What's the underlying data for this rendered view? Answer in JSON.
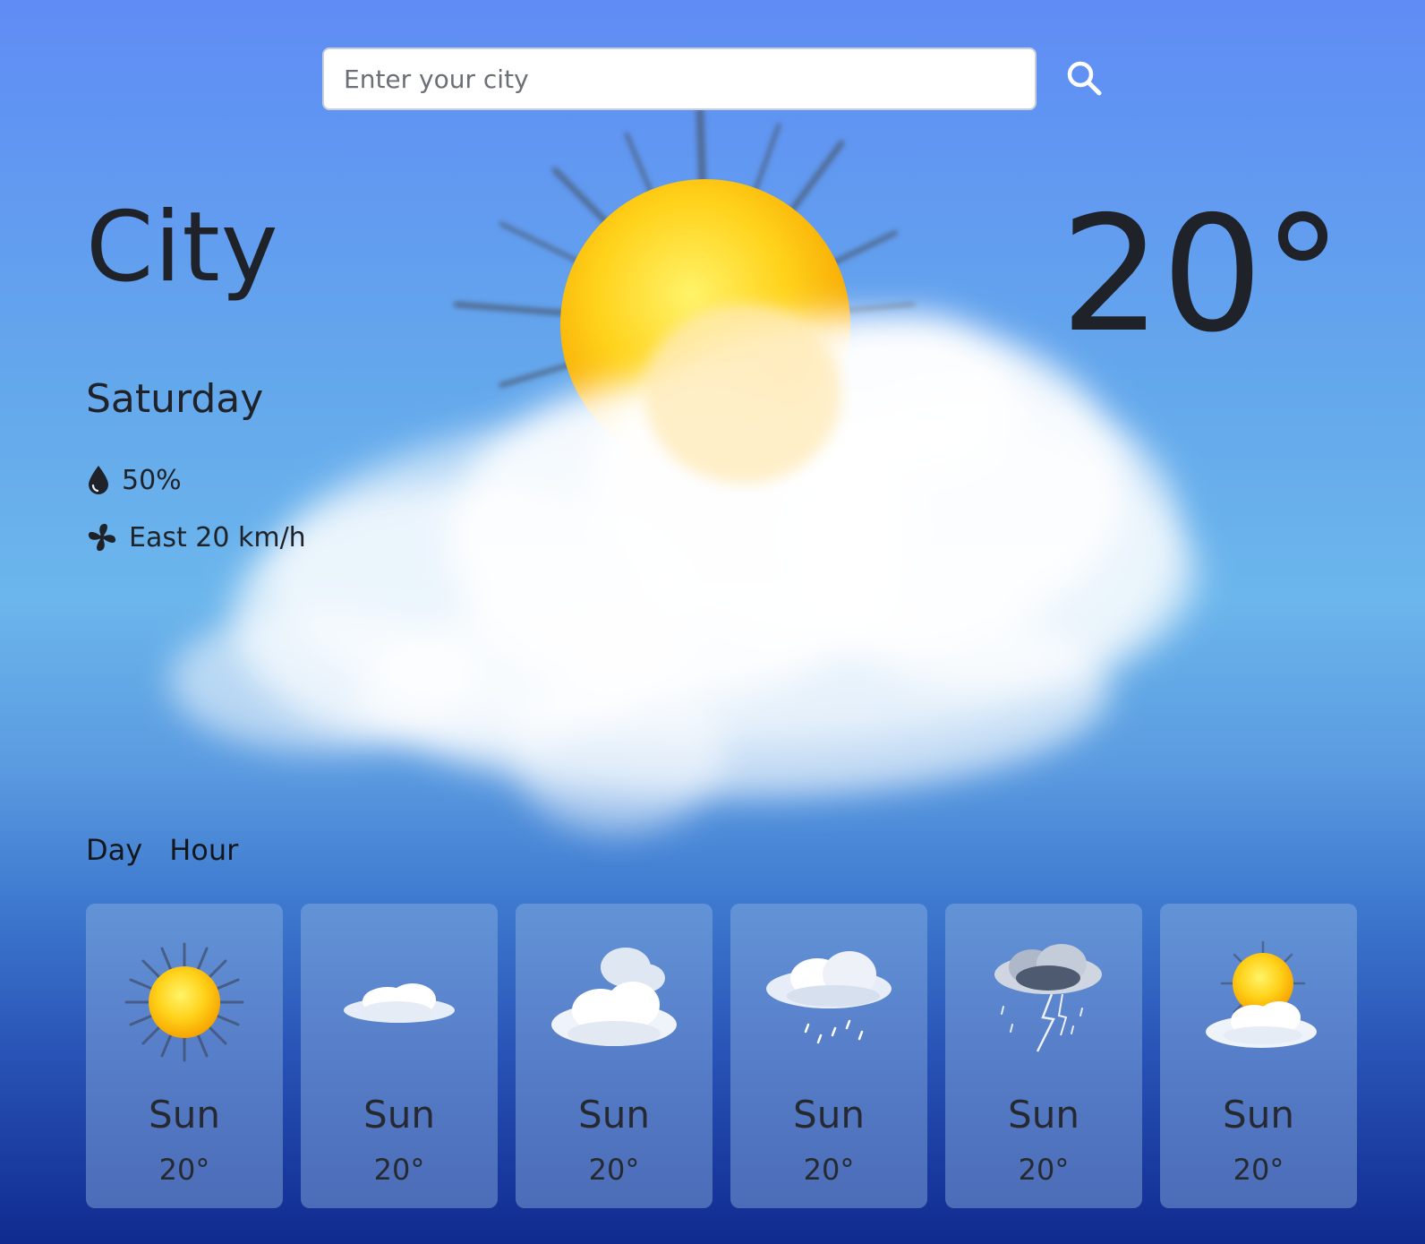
{
  "search": {
    "placeholder": "Enter your city",
    "icon": "search-icon"
  },
  "current": {
    "city": "City",
    "temperature": "20°",
    "day": "Saturday",
    "humidity": "50%",
    "humidity_icon": "droplet-icon",
    "wind": "East 20 km/h",
    "wind_icon": "fan-icon",
    "condition_art": "sun-behind-cloud"
  },
  "tabs": [
    {
      "label": "Day"
    },
    {
      "label": "Hour"
    }
  ],
  "forecast": [
    {
      "day": "Sun",
      "temp": "20°",
      "icon": "sun-icon"
    },
    {
      "day": "Sun",
      "temp": "20°",
      "icon": "small-cloud-icon"
    },
    {
      "day": "Sun",
      "temp": "20°",
      "icon": "cloudy-icon"
    },
    {
      "day": "Sun",
      "temp": "20°",
      "icon": "rain-icon"
    },
    {
      "day": "Sun",
      "temp": "20°",
      "icon": "thunderstorm-icon"
    },
    {
      "day": "Sun",
      "temp": "20°",
      "icon": "partly-sunny-icon"
    }
  ],
  "colors": {
    "background_top": "#5f8cf5",
    "background_bottom": "#0f2a8f",
    "text": "#1f2329",
    "card": "rgba(145,180,225,0.45)"
  }
}
